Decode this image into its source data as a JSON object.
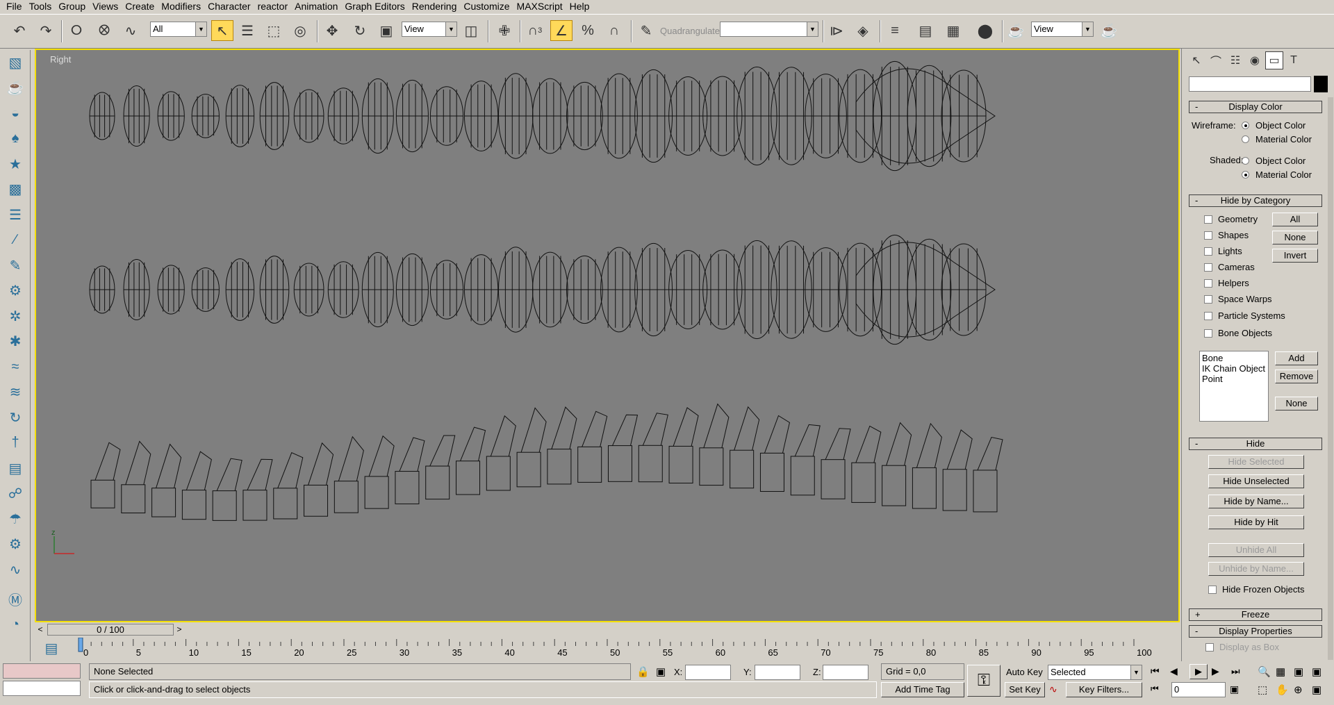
{
  "menubar": {
    "items": [
      "File",
      "Tools",
      "Group",
      "Views",
      "Create",
      "Modifiers",
      "Character",
      "reactor",
      "Animation",
      "Graph Editors",
      "Rendering",
      "Customize",
      "MAXScript",
      "Help"
    ]
  },
  "toolbar": {
    "selection_filter": "All",
    "ref_coord": "View",
    "quadrangulate": "Quadrangulate",
    "named_sel_value": "",
    "render_view": "View",
    "snap_badge": "3"
  },
  "viewport": {
    "label": "Right",
    "border_color": "#f5e000",
    "bg_color": "#7f7f7f",
    "axis_label": "z"
  },
  "timeline": {
    "slider_text": "0 / 100",
    "ticks": [
      "0",
      "5",
      "10",
      "15",
      "20",
      "25",
      "30",
      "35",
      "40",
      "45",
      "50",
      "55",
      "60",
      "65",
      "70",
      "75",
      "80",
      "85",
      "90",
      "95",
      "100"
    ]
  },
  "status": {
    "selection": "None Selected",
    "prompt": "Click or click-and-drag to select objects",
    "x_label": "X:",
    "y_label": "Y:",
    "z_label": "Z:",
    "grid": "Grid = 0,0",
    "add_time_tag": "Add Time Tag",
    "auto_key": "Auto Key",
    "set_key": "Set Key",
    "key_mode": "Selected",
    "key_filters": "Key Filters...",
    "frame": "0"
  },
  "panel": {
    "display_color": {
      "title": "Display Color",
      "wireframe_label": "Wireframe:",
      "shaded_label": "Shaded:",
      "object_color": "Object Color",
      "material_color": "Material Color"
    },
    "hide_by_category": {
      "title": "Hide by Category",
      "categories": [
        "Geometry",
        "Shapes",
        "Lights",
        "Cameras",
        "Helpers",
        "Space Warps",
        "Particle Systems",
        "Bone Objects"
      ],
      "all": "All",
      "none": "None",
      "invert": "Invert",
      "list": [
        "Bone",
        "IK Chain Object",
        "Point"
      ],
      "add": "Add",
      "remove": "Remove",
      "none2": "None"
    },
    "hide": {
      "title": "Hide",
      "hide_selected": "Hide Selected",
      "hide_unselected": "Hide Unselected",
      "hide_by_name": "Hide by Name...",
      "hide_by_hit": "Hide by Hit",
      "unhide_all": "Unhide All",
      "unhide_by_name": "Unhide by Name...",
      "hide_frozen": "Hide Frozen Objects"
    },
    "freeze": {
      "title": "Freeze",
      "pm": "+"
    },
    "display_properties": {
      "title": "Display Properties",
      "display_as_box": "Display as Box"
    },
    "minus": "-"
  }
}
